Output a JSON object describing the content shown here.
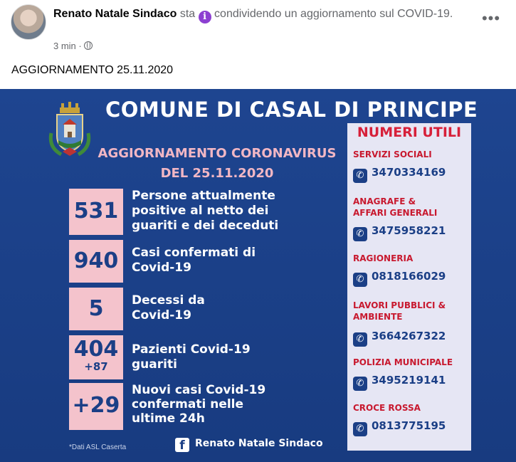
{
  "post": {
    "author": "Renato Natale Sindaco",
    "action_prefix": " sta ",
    "action_text": " condividendo un aggiornamento sul COVID-19.",
    "time": "3 min",
    "separator": " · ",
    "more_label": "•••",
    "text": "AGGIORNAMENTO 25.11.2020",
    "icons": {
      "info": "info-icon",
      "globe": "globe-icon",
      "more": "more-icon"
    }
  },
  "graphic": {
    "title": "COMUNE DI CASAL DI PRINCIPE",
    "subtitle": "AGGIORNAMENTO CORONAVIRUS",
    "date": "DEL 25.11.2020",
    "stats": [
      {
        "value": "531",
        "extra": "",
        "label": "Persone attualmente\npositive al netto dei\nguariti e dei deceduti"
      },
      {
        "value": "940",
        "extra": "",
        "label": "Casi confermati di\nCovid-19"
      },
      {
        "value": "5",
        "extra": "",
        "label": "Decessi da\nCovid-19"
      },
      {
        "value": "404",
        "extra": "+87",
        "label": "Pazienti Covid-19\nguariti"
      },
      {
        "value": "+29",
        "extra": "",
        "label": "Nuovi casi Covid-19\nconfermati nelle\nultime 24h"
      }
    ],
    "footnote": "*Dati ASL Caserta",
    "credit": "Renato Natale Sindaco",
    "fb_logo": "f",
    "numbers_title": "NUMERI UTILI",
    "contacts": [
      {
        "name": "SERVIZI SOCIALI",
        "phone": "3470334169"
      },
      {
        "name": "ANAGRAFE &\nAFFARI GENERALI",
        "phone": "3475958221"
      },
      {
        "name": "RAGIONERIA",
        "phone": "0818166029"
      },
      {
        "name": "LAVORI PUBBLICI &\nAMBIENTE",
        "phone": "3664267322"
      },
      {
        "name": "POLIZIA MUNICIPALE",
        "phone": "3495219141"
      },
      {
        "name": "CROCE ROSSA",
        "phone": "0813775195"
      }
    ],
    "colors": {
      "background": "#1b3f86",
      "stat_box": "#f4c3cc",
      "accent_red": "#c8192f",
      "panel": "#e6e6f4"
    }
  }
}
